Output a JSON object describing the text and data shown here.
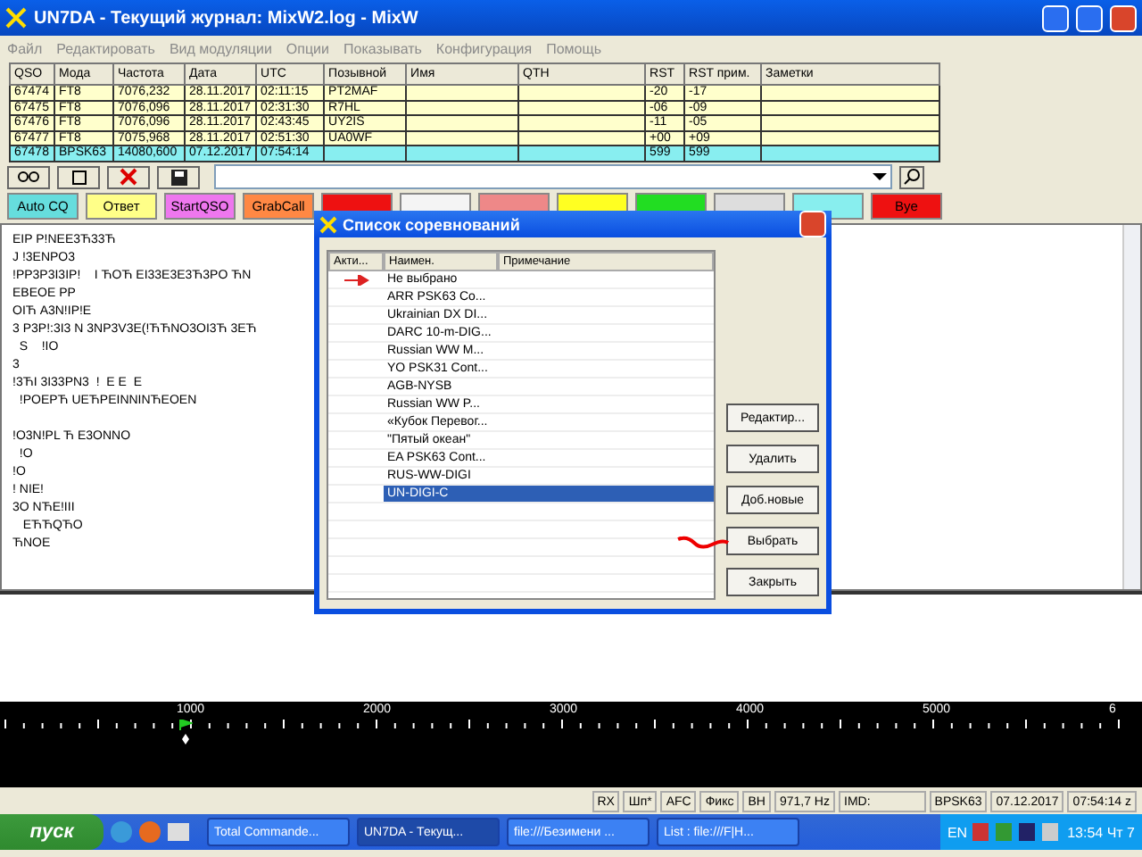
{
  "window": {
    "title": "UN7DA - Текущий журнал: MixW2.log - MixW"
  },
  "menu": [
    {
      "label": "Файл"
    },
    {
      "label": "Редактировать"
    },
    {
      "label": "Вид модуляции"
    },
    {
      "label": "Опции"
    },
    {
      "label": "Показывать"
    },
    {
      "label": "Конфигурация"
    },
    {
      "label": "Помощь"
    }
  ],
  "log_table": {
    "columns": [
      "QSO",
      "Мода",
      "Частота",
      "Дата",
      "UTC",
      "Позывной",
      "Имя",
      "QTH",
      "RST",
      "RST прим.",
      "Заметки"
    ],
    "rows": [
      {
        "selected": false,
        "cells": [
          "67474",
          "FT8",
          "7076,232",
          "28.11.2017",
          "02:11:15",
          "PT2MAF",
          "",
          "",
          "-20",
          "-17",
          ""
        ]
      },
      {
        "selected": false,
        "cells": [
          "67475",
          "FT8",
          "7076,096",
          "28.11.2017",
          "02:31:30",
          "R7HL",
          "",
          "",
          "-06",
          "-09",
          ""
        ]
      },
      {
        "selected": false,
        "cells": [
          "67476",
          "FT8",
          "7076,096",
          "28.11.2017",
          "02:43:45",
          "UY2IS",
          "",
          "",
          "-11",
          "-05",
          ""
        ]
      },
      {
        "selected": false,
        "cells": [
          "67477",
          "FT8",
          "7075,968",
          "28.11.2017",
          "02:51:30",
          "UA0WF",
          "",
          "",
          "+00",
          "+09",
          ""
        ]
      },
      {
        "selected": true,
        "cells": [
          "67478",
          "BPSK63",
          "14080,600",
          "07.12.2017",
          "07:54:14",
          "",
          "",
          "",
          "599",
          "599",
          ""
        ]
      }
    ]
  },
  "macro_buttons": [
    {
      "label": "Auto CQ",
      "color": "#66dddd"
    },
    {
      "label": "Ответ",
      "color": "#ffff88"
    },
    {
      "label": "StartQSO",
      "color": "#ee77ee"
    },
    {
      "label": "GrabCall",
      "color": "#ff8844"
    },
    {
      "color": "#ee1111"
    },
    {
      "color": "#f4f4f4"
    },
    {
      "color": "#ee8888"
    },
    {
      "color": "#ffff22"
    },
    {
      "color": "#22dd22"
    },
    {
      "color": "#dddddd"
    },
    {
      "color": "#88eeee"
    },
    {
      "label": "Bye",
      "color": "#ee1111"
    }
  ],
  "receive_text": [
    [
      "EIP P!NEE3Ћ33Ћ",
      "J !3ENPO3",
      "!PP3P3I3IP!    I ЋOЋ EI33E3E3Ћ3PO ЋN",
      "EBEOE PP",
      "OIЋ A3N!IP!E",
      "3 P3P!:3I3 N 3NP3V3E(!ЋЋNO3OI3Ћ 3EЋ",
      "  S    !IO",
      "3",
      "!3ЋI 3I33PN3  !  E E  E",
      "  !POEPЋ UEЋPEINNINЋEOEN"
    ],
    [
      "!O3N!PL Ћ E3ONNO",
      "  !O",
      "!O",
      "! NIE!",
      "3O NЋE!III",
      "   EЋЋQЋO",
      "ЋNOE"
    ]
  ],
  "dialog": {
    "title": "Список соревнований",
    "columns": [
      "Акти...",
      "Наимен.",
      "Примечание"
    ],
    "items": [
      {
        "name": "Не выбрано",
        "active": true,
        "selected": false
      },
      {
        "name": "ARR PSK63 Co...",
        "active": false,
        "selected": false
      },
      {
        "name": "Ukrainian DX DI...",
        "active": false,
        "selected": false
      },
      {
        "name": "DARC 10-m-DIG...",
        "active": false,
        "selected": false
      },
      {
        "name": "Russian WW M...",
        "active": false,
        "selected": false
      },
      {
        "name": "YO PSK31 Cont...",
        "active": false,
        "selected": false
      },
      {
        "name": "AGB-NYSB",
        "active": false,
        "selected": false
      },
      {
        "name": "Russian WW P...",
        "active": false,
        "selected": false
      },
      {
        "name": "«Кубок Перевог...",
        "active": false,
        "selected": false
      },
      {
        "name": "\"Пятый океан\"",
        "active": false,
        "selected": false
      },
      {
        "name": "EA PSK63 Cont...",
        "active": false,
        "selected": false
      },
      {
        "name": "RUS-WW-DIGI",
        "active": false,
        "selected": false
      },
      {
        "name": "UN-DIGI-C",
        "active": false,
        "selected": true
      }
    ],
    "buttons": [
      "Редактир...",
      "Удалить",
      "Доб.новые",
      "Выбрать",
      "Закрыть"
    ]
  },
  "waterfall": {
    "scale": [
      "1000",
      "2000",
      "3000",
      "4000",
      "5000",
      "6"
    ]
  },
  "status_bar": [
    "RX",
    "Шп*",
    "AFC",
    "Фикс",
    "BH",
    "971,7 Hz",
    "IMD:",
    "BPSK63",
    "07.12.2017",
    "07:54:14 z"
  ],
  "taskbar": {
    "start": "пуск",
    "tasks": [
      {
        "label": "Total Commande...",
        "selected": false
      },
      {
        "label": "UN7DA - Текущ...",
        "selected": true
      },
      {
        "label": "file:///Безимени ...",
        "selected": false
      },
      {
        "label": "List : file:///F|H...",
        "selected": false
      }
    ],
    "language": "EN",
    "clock": "13:54 Чт 7"
  }
}
